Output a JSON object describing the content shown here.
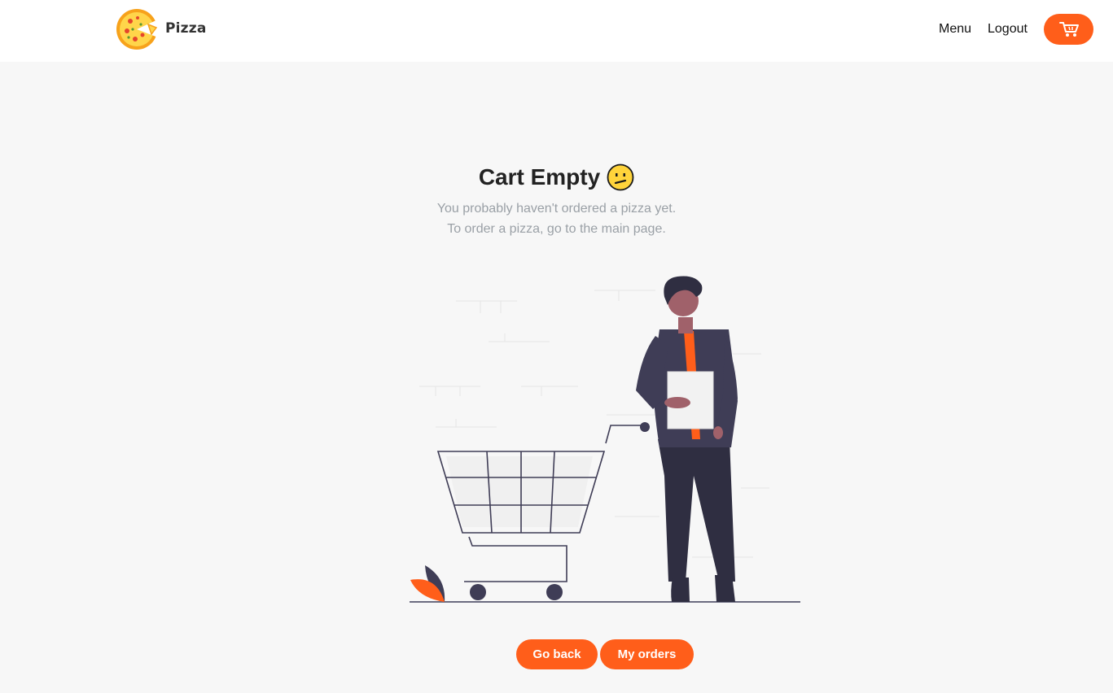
{
  "header": {
    "brand": "Pizza",
    "nav": {
      "menu": "Menu",
      "logout": "Logout"
    },
    "logo_icon": "pizza-icon",
    "cart_icon": "cart-icon"
  },
  "empty_state": {
    "title": "Cart Empty",
    "emoji": "😕",
    "line1": "You probably haven't ordered a pizza yet.",
    "line2": "To order a pizza, go to the main page."
  },
  "actions": {
    "go_back": "Go back",
    "my_orders": "My orders"
  },
  "colors": {
    "accent": "#ff5e1a",
    "background": "#f7f7f7",
    "text_muted": "#9aa0a6"
  }
}
